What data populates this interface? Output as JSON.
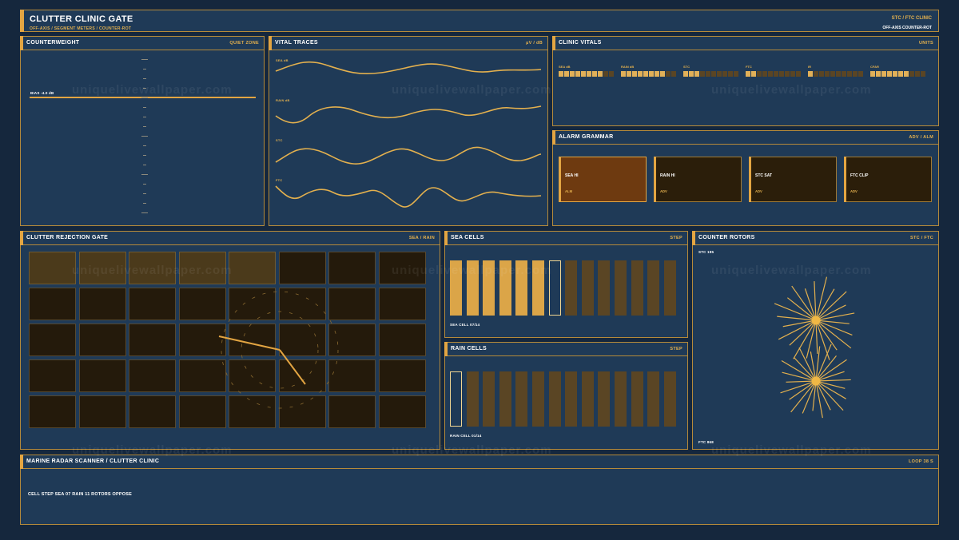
{
  "header": {
    "title": "CLUTTER CLINIC GATE",
    "subtitle": "OFF-AXIS  /  SEGMENT METERS  /  COUNTER-ROT",
    "right_title": "STC / FTC CLINIC",
    "right_sub": "OFF-AXIS  COUNTER-ROT"
  },
  "watermark": "uniquelivewallpaper.com",
  "counterweight": {
    "title": "COUNTERWEIGHT",
    "tag": "QUIET ZONE",
    "bias_label": "BIAS -4.0 dB"
  },
  "vital_traces": {
    "title": "VITAL TRACES",
    "tag": "µV / dB",
    "traces": [
      "SEA dB",
      "RAIN dB",
      "STC",
      "FTC"
    ]
  },
  "clinic_vitals": {
    "title": "CLINIC VITALS",
    "tag": "UNITS",
    "items": [
      {
        "label": "SEA dB",
        "level": 0.8
      },
      {
        "label": "RAIN dB",
        "level": 0.8
      },
      {
        "label": "STC",
        "level": 0.3
      },
      {
        "label": "FTC",
        "level": 0.2
      },
      {
        "label": "IR",
        "level": 0.1
      },
      {
        "label": "CFAR",
        "level": 0.7
      }
    ]
  },
  "alarm_grammar": {
    "title": "ALARM GRAMMAR",
    "tag": "ADV / ALM",
    "alarms": [
      {
        "name": "SEA HI",
        "state": "ALM",
        "active": true
      },
      {
        "name": "RAIN HI",
        "state": "ADV",
        "active": false
      },
      {
        "name": "STC SAT",
        "state": "ADV",
        "active": false
      },
      {
        "name": "FTC CLIP",
        "state": "ADV",
        "active": false
      }
    ]
  },
  "rejection_gate": {
    "title": "CLUTTER REJECTION GATE",
    "tag": "SEA / RAIN",
    "rows": 5,
    "cols": 8,
    "lit_cells": 5
  },
  "sea_cells": {
    "title": "SEA CELLS",
    "tag": "STEP",
    "total": 14,
    "current": 7,
    "caption": "SEA CELL 07/14"
  },
  "rain_cells": {
    "title": "RAIN CELLS",
    "tag": "STEP",
    "total": 14,
    "current": 1,
    "caption": "RAIN CELL 01/14"
  },
  "counter_rotors": {
    "title": "COUNTER ROTORS",
    "tag": "STC / FTC",
    "stc_label": "STC 195",
    "ftc_label": "FTC 868"
  },
  "footer": {
    "title": "MARINE RADAR SCANNER  /  CLUTTER CLINIC",
    "tag": "LOOP 38 S",
    "status": "CELL STEP  SEA 07  RAIN 11  ROTORS OPPOSE"
  }
}
